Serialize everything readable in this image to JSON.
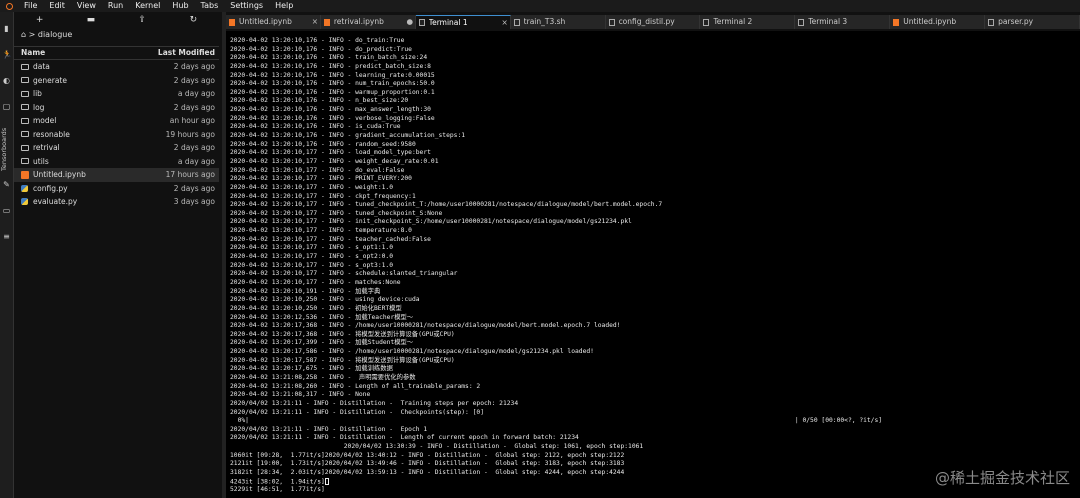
{
  "menu": [
    "File",
    "Edit",
    "View",
    "Run",
    "Kernel",
    "Hub",
    "Tabs",
    "Settings",
    "Help"
  ],
  "activity": {
    "tensorboards_label": "Tensorboards"
  },
  "filebrowser": {
    "toolbar": [
      "+",
      "",
      "",
      ""
    ],
    "breadcrumb": "dialogue",
    "header": {
      "name": "Name",
      "modified": "Last Modified"
    },
    "items": [
      {
        "name": "data",
        "modified": "2 days ago",
        "type": "folder"
      },
      {
        "name": "generate",
        "modified": "2 days ago",
        "type": "folder"
      },
      {
        "name": "lib",
        "modified": "a day ago",
        "type": "folder"
      },
      {
        "name": "log",
        "modified": "2 days ago",
        "type": "folder"
      },
      {
        "name": "model",
        "modified": "an hour ago",
        "type": "folder"
      },
      {
        "name": "resonable",
        "modified": "19 hours ago",
        "type": "folder"
      },
      {
        "name": "retrival",
        "modified": "2 days ago",
        "type": "folder"
      },
      {
        "name": "utils",
        "modified": "a day ago",
        "type": "folder"
      },
      {
        "name": "Untitled.ipynb",
        "modified": "17 hours ago",
        "type": "notebook"
      },
      {
        "name": "config.py",
        "modified": "2 days ago",
        "type": "python"
      },
      {
        "name": "evaluate.py",
        "modified": "3 days ago",
        "type": "python"
      }
    ]
  },
  "tabs": [
    {
      "label": "Untitled.ipynb",
      "icon": "notebook",
      "close": "×"
    },
    {
      "label": "retrival.ipynb",
      "icon": "notebook",
      "close": "●"
    },
    {
      "label": "Terminal 1",
      "icon": "terminal",
      "close": "×",
      "active": true
    },
    {
      "label": "train_T3.sh",
      "icon": "text",
      "close": ""
    },
    {
      "label": "config_distil.py",
      "icon": "text",
      "close": ""
    },
    {
      "label": "Terminal 2",
      "icon": "terminal",
      "close": ""
    },
    {
      "label": "Terminal 3",
      "icon": "terminal",
      "close": ""
    },
    {
      "label": "Untitled.ipynb",
      "icon": "notebook",
      "close": ""
    },
    {
      "label": "parser.py",
      "icon": "text",
      "close": ""
    }
  ],
  "terminal": {
    "lines": [
      "2020-04-02 13:20:10,176 - INFO - do_train:True",
      "2020-04-02 13:20:10,176 - INFO - do_predict:True",
      "2020-04-02 13:20:10,176 - INFO - train_batch_size:24",
      "2020-04-02 13:20:10,176 - INFO - predict_batch_size:8",
      "2020-04-02 13:20:10,176 - INFO - learning_rate:0.00015",
      "2020-04-02 13:20:10,176 - INFO - num_train_epochs:50.0",
      "2020-04-02 13:20:10,176 - INFO - warmup_proportion:0.1",
      "2020-04-02 13:20:10,176 - INFO - n_best_size:20",
      "2020-04-02 13:20:10,176 - INFO - max_answer_length:30",
      "2020-04-02 13:20:10,176 - INFO - verbose_logging:False",
      "2020-04-02 13:20:10,176 - INFO - is_cuda:True",
      "2020-04-02 13:20:10,176 - INFO - gradient_accumulation_steps:1",
      "2020-04-02 13:20:10,176 - INFO - random_seed:9580",
      "2020-04-02 13:20:10,177 - INFO - load_model_type:bert",
      "2020-04-02 13:20:10,177 - INFO - weight_decay_rate:0.01",
      "2020-04-02 13:20:10,177 - INFO - do_eval:False",
      "2020-04-02 13:20:10,177 - INFO - PRINT_EVERY:200",
      "2020-04-02 13:20:10,177 - INFO - weight:1.0",
      "2020-04-02 13:20:10,177 - INFO - ckpt_frequency:1",
      "2020-04-02 13:20:10,177 - INFO - tuned_checkpoint_T:/home/user10000281/notespace/dialogue/model/bert.model.epoch.7",
      "2020-04-02 13:20:10,177 - INFO - tuned_checkpoint_S:None",
      "2020-04-02 13:20:10,177 - INFO - init_checkpoint_S:/home/user10000281/notespace/dialogue/model/gs21234.pkl",
      "2020-04-02 13:20:10,177 - INFO - temperature:8.0",
      "2020-04-02 13:20:10,177 - INFO - teacher_cached:False",
      "2020-04-02 13:20:10,177 - INFO - s_opt1:1.0",
      "2020-04-02 13:20:10,177 - INFO - s_opt2:0.0",
      "2020-04-02 13:20:10,177 - INFO - s_opt3:1.0",
      "2020-04-02 13:20:10,177 - INFO - schedule:slanted_triangular",
      "2020-04-02 13:20:10,177 - INFO - matches:None",
      "2020-04-02 13:20:10,191 - INFO - 加载字典",
      "2020-04-02 13:20:10,250 - INFO - using device:cuda",
      "2020-04-02 13:20:10,250 - INFO - 初始化BERT模型",
      "2020-04-02 13:20:12,536 - INFO - 加载Teacher模型～",
      "2020-04-02 13:20:17,368 - INFO - /home/user10000281/notespace/dialogue/model/bert.model.epoch.7 loaded!",
      "2020-04-02 13:20:17,368 - INFO - 将模型发送到计算设备(GPU或CPU)",
      "2020-04-02 13:20:17,399 - INFO - 加载Student模型～",
      "2020-04-02 13:20:17,586 - INFO - /home/user10000281/notespace/dialogue/model/gs21234.pkl loaded!",
      "2020-04-02 13:20:17,587 - INFO - 将模型发送到计算设备(GPU或CPU)",
      "2020-04-02 13:20:17,675 - INFO - 加载训练数据",
      "2020-04-02 13:21:08,258 - INFO -  声明需要优化的参数",
      "2020-04-02 13:21:08,260 - INFO - Length of all_trainable_params: 2",
      "2020-04-02 13:21:08,317 - INFO - None",
      "2020/04/02 13:21:11 - INFO - Distillation -  Training steps per epoch: 21234",
      "2020/04/02 13:21:11 - INFO - Distillation -  Checkpoints(step): [0]",
      "  0%|                                                                                                                                                | 0/50 [00:00<?, ?it/s]",
      "2020/04/02 13:21:11 - INFO - Distillation -  Epoch 1",
      "2020/04/02 13:21:11 - INFO - Distillation -  Length of current epoch in forward batch: 21234",
      "                              2020/04/02 13:30:39 - INFO - Distillation -  Global step: 1061, epoch step:1061",
      "1060it [09:28,  1.77it/s]2020/04/02 13:40:12 - INFO - Distillation -  Global step: 2122, epoch step:2122",
      "2121it [19:00,  1.73it/s]2020/04/02 13:49:46 - INFO - Distillation -  Global step: 3183, epoch step:3183",
      "3182it [28:34,  2.03it/s]2020/04/02 13:59:13 - INFO - Distillation -  Global step: 4244, epoch step:4244",
      "4243it [38:02,  1.94it/s]",
      "5229it [46:51,  1.77it/s]"
    ],
    "watermark": "@稀土掘金技术社区"
  }
}
